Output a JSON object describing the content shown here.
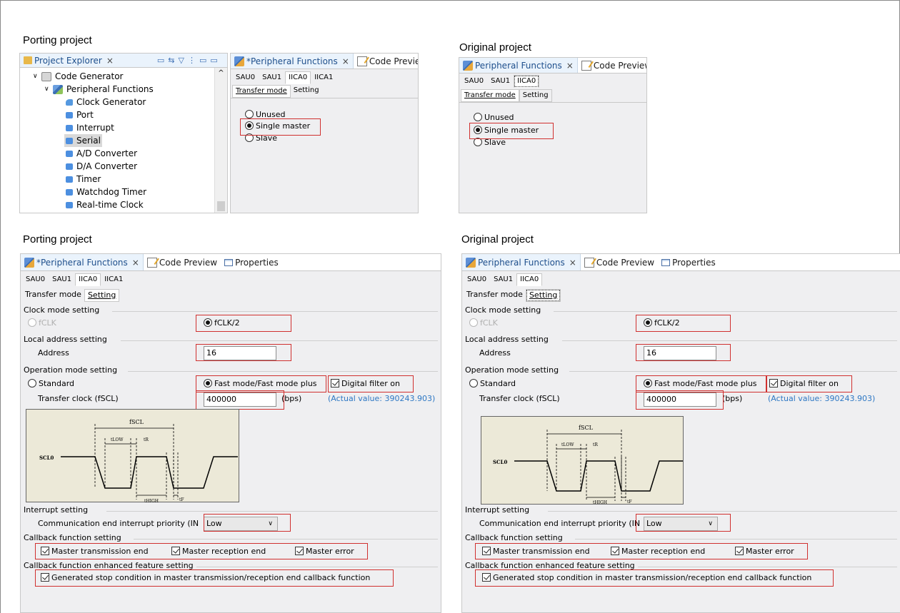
{
  "captions": {
    "top_left": "Porting project",
    "top_right": "Original project",
    "bottom_left": "Porting project",
    "bottom_right": "Original project"
  },
  "project_explorer": {
    "tab_label": "Project Explorer",
    "close": "×",
    "tree": [
      {
        "label": "Code Generator",
        "arrow": "∨"
      },
      {
        "label": "Peripheral Functions",
        "arrow": "∨"
      },
      {
        "label": "Clock Generator"
      },
      {
        "label": "Port"
      },
      {
        "label": "Interrupt"
      },
      {
        "label": "Serial"
      },
      {
        "label": "A/D Converter"
      },
      {
        "label": "D/A Converter"
      },
      {
        "label": "Timer"
      },
      {
        "label": "Watchdog Timer"
      },
      {
        "label": "Real-time Clock"
      }
    ],
    "scroll_up": "^"
  },
  "porting_top": {
    "tabs": {
      "peripheral": "*Peripheral Functions",
      "close": "×",
      "code_preview": "Code Preview"
    },
    "channels": [
      "SAU0",
      "SAU1",
      "IICA0",
      "IICA1"
    ],
    "mode_tabs": [
      "Transfer mode",
      "Setting"
    ],
    "options": [
      "Unused",
      "Single master",
      "Slave"
    ]
  },
  "original_top": {
    "tabs": {
      "peripheral": "Peripheral Functions",
      "close": "×",
      "code_preview": "Code Preview",
      "cut": "P"
    },
    "channels": [
      "SAU0",
      "SAU1",
      "IICA0"
    ],
    "mode_tabs": [
      "Transfer mode",
      "Setting"
    ],
    "options": [
      "Unused",
      "Single master",
      "Slave"
    ]
  },
  "porting_bottom": {
    "tabs": {
      "peripheral": "*Peripheral Functions",
      "close": "×",
      "code_preview": "Code Preview",
      "properties": "Properties"
    },
    "channels": [
      "SAU0",
      "SAU1",
      "IICA0",
      "IICA1"
    ],
    "mode_tabs": [
      "Transfer mode",
      "Setting"
    ]
  },
  "original_bottom": {
    "tabs": {
      "peripheral": "Peripheral Functions",
      "close": "×",
      "code_preview": "Code Preview",
      "properties": "Properties"
    },
    "channels": [
      "SAU0",
      "SAU1",
      "IICA0"
    ],
    "mode_tabs": [
      "Transfer mode",
      "Setting"
    ]
  },
  "settings": {
    "clock_group": "Clock mode setting",
    "fclk": "fCLK",
    "fclk2": "fCLK/2",
    "local_group": "Local address setting",
    "address_label": "Address",
    "address_value": "16",
    "operation_group": "Operation mode setting",
    "standard": "Standard",
    "fast": "Fast mode/Fast mode plus",
    "digital_filter": "Digital filter on",
    "transfer_clock_label": "Transfer clock (fSCL)",
    "transfer_clock_value": "400000",
    "bps": "(bps)",
    "actual": "(Actual value: 390243.903)",
    "wave": {
      "fscl": "fSCL",
      "tlow": "tLOW",
      "tr": "tR",
      "thigh": "tHIGH",
      "tf": "tF",
      "scl": "SCL0"
    },
    "interrupt_group": "Interrupt setting",
    "priority_label": "Communication end interrupt priority (IN",
    "priority_value": "Low",
    "priority_arrow": "∨",
    "callback_group": "Callback function setting",
    "master_tx": "Master transmission end",
    "master_rx": "Master reception end",
    "master_err": "Master error",
    "enhanced_group": "Callback function enhanced feature setting",
    "stop_condition": "Generated stop condition in master transmission/reception end callback function"
  },
  "colors": {
    "highlight_red": "#d0302f",
    "actual_blue": "#2e78c4",
    "panel_bg": "#efeff1"
  }
}
